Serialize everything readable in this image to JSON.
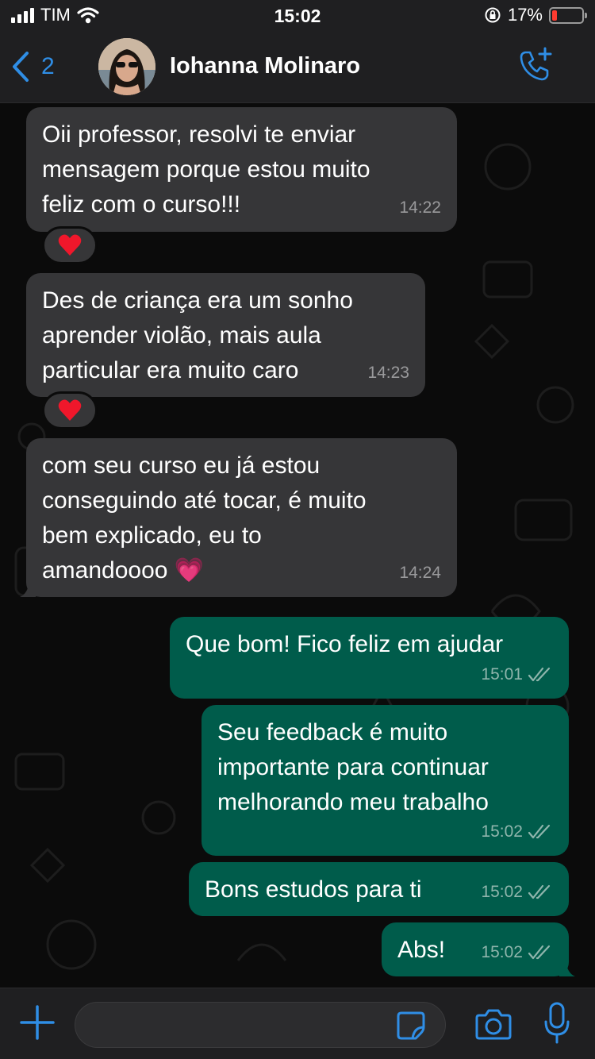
{
  "status_bar": {
    "carrier": "TIM",
    "time": "15:02",
    "battery_percent": "17%",
    "battery_level": 0.17
  },
  "header": {
    "back_count": "2",
    "contact_name": "Iohanna Molinaro"
  },
  "messages": [
    {
      "direction": "incoming",
      "text": "Oii professor, resolvi te enviar\nmensagem porque estou muito\nfeliz com o curso!!!",
      "time": "14:22",
      "reaction": "❤️"
    },
    {
      "direction": "incoming",
      "text": "Des de criança era um sonho\naprender violão, mais aula\nparticular era muito caro",
      "time": "14:23",
      "reaction": "❤️"
    },
    {
      "direction": "incoming",
      "text": "com seu curso eu já estou\nconseguindo até tocar, é muito\nbem explicado, eu to\namandoooo 💗",
      "time": "14:24"
    },
    {
      "direction": "outgoing",
      "text": "Que bom! Fico feliz em ajudar",
      "time": "15:01",
      "status": "read"
    },
    {
      "direction": "outgoing",
      "text": "Seu feedback é muito\nimportante para continuar\nmelhorando meu trabalho",
      "time": "15:02",
      "status": "read"
    },
    {
      "direction": "outgoing",
      "text": "Bons estudos para ti",
      "time": "15:02",
      "status": "read"
    },
    {
      "direction": "outgoing",
      "text": "Abs!",
      "time": "15:02",
      "status": "read"
    }
  ],
  "input": {
    "value": "",
    "placeholder": ""
  },
  "icons": {
    "back": "chevron-left-icon",
    "call": "add-call-icon",
    "plus": "plus-icon",
    "sticker": "sticker-icon",
    "camera": "camera-icon",
    "mic": "microphone-icon"
  },
  "colors": {
    "accent": "#2f8ee6",
    "incoming_bubble": "#363638",
    "outgoing_bubble": "#005c4b",
    "chat_background": "#0b0b0b",
    "bar_background": "#1f1f21"
  }
}
